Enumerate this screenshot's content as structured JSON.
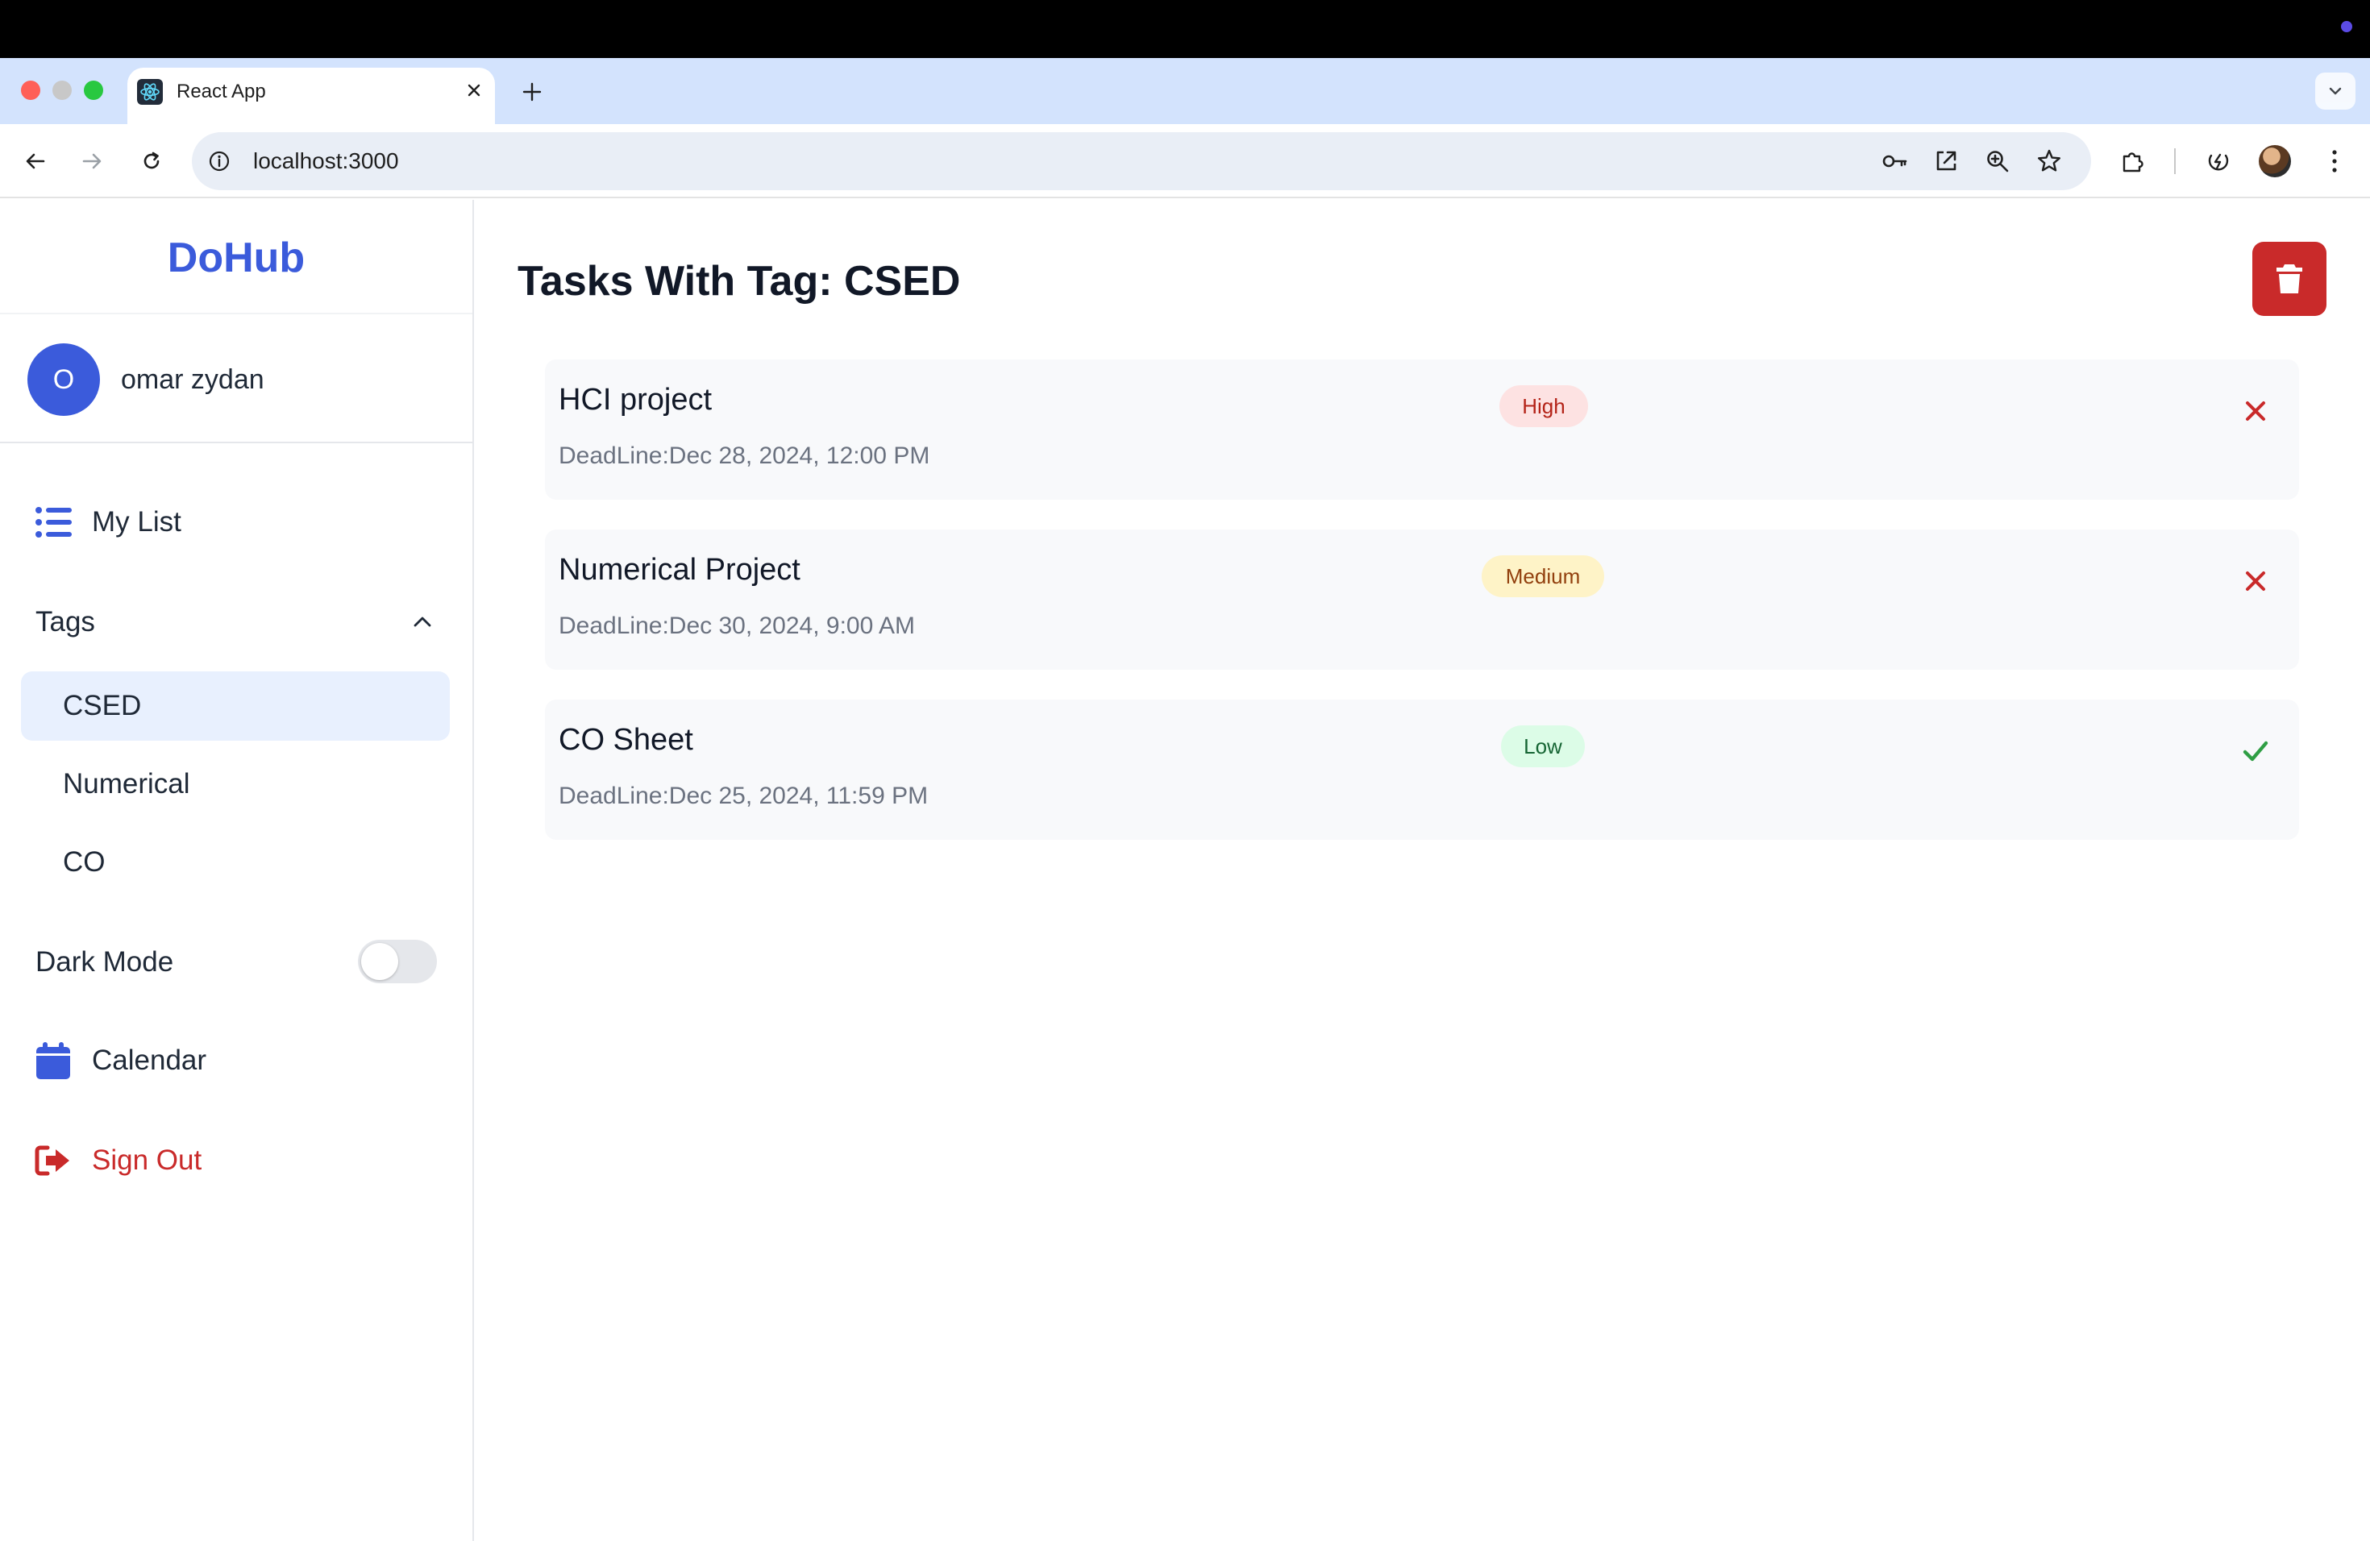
{
  "browser": {
    "tab_title": "React App",
    "url": "localhost:3000"
  },
  "sidebar": {
    "brand": "DoHub",
    "user": {
      "initial": "O",
      "name": "omar zydan"
    },
    "my_list_label": "My List",
    "tags_label": "Tags",
    "tags": [
      {
        "label": "CSED",
        "active": true
      },
      {
        "label": "Numerical",
        "active": false
      },
      {
        "label": "CO",
        "active": false
      }
    ],
    "dark_mode_label": "Dark Mode",
    "dark_mode_on": false,
    "calendar_label": "Calendar",
    "sign_out_label": "Sign Out"
  },
  "main": {
    "title": "Tasks With Tag: CSED",
    "tasks": [
      {
        "title": "HCI project",
        "deadline": "DeadLine:Dec 28, 2024, 12:00 PM",
        "priority": "High",
        "status": "incomplete"
      },
      {
        "title": "Numerical Project",
        "deadline": "DeadLine:Dec 30, 2024, 9:00 AM",
        "priority": "Medium",
        "status": "incomplete"
      },
      {
        "title": "CO Sheet",
        "deadline": "DeadLine:Dec 25, 2024, 11:59 PM",
        "priority": "Low",
        "status": "complete"
      }
    ]
  },
  "colors": {
    "brand": "#3b5bdb",
    "danger": "#c92a2a",
    "success": "#2f9e44"
  },
  "icons": {
    "my_list": "list-icon",
    "tags_toggle": "chevron-up-icon",
    "calendar": "calendar-icon",
    "sign_out": "sign-out-icon",
    "delete_all": "trash-icon",
    "incomplete": "close-icon",
    "complete": "check-icon"
  }
}
